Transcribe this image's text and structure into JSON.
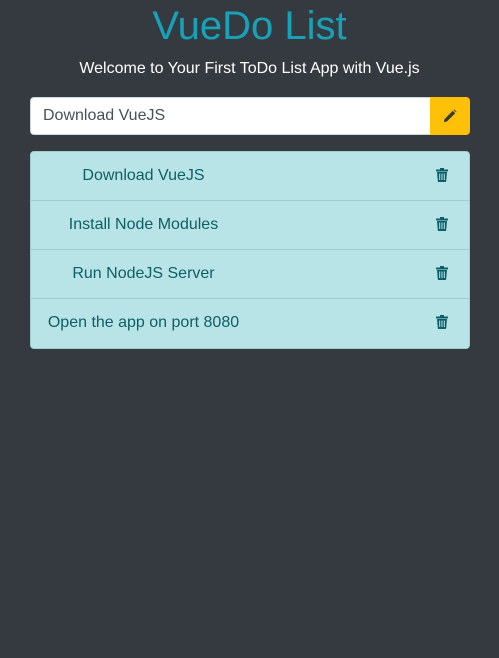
{
  "app": {
    "title": "VueDo List",
    "subtitle": "Welcome to Your First ToDo List App with Vue.js"
  },
  "input": {
    "value": "Download VueJS",
    "edit_icon": "pencil-icon"
  },
  "todos": [
    {
      "text": "Download VueJS",
      "delete_icon": "trash-icon"
    },
    {
      "text": "Install Node Modules",
      "delete_icon": "trash-icon"
    },
    {
      "text": "Run NodeJS Server",
      "delete_icon": "trash-icon"
    },
    {
      "text": "Open the app on port 8080",
      "delete_icon": "trash-icon"
    }
  ],
  "colors": {
    "background": "#343a40",
    "title": "#17a2b8",
    "edit_button": "#ffc107",
    "list_background": "#b8e4e8",
    "list_text": "#0d5f65"
  }
}
